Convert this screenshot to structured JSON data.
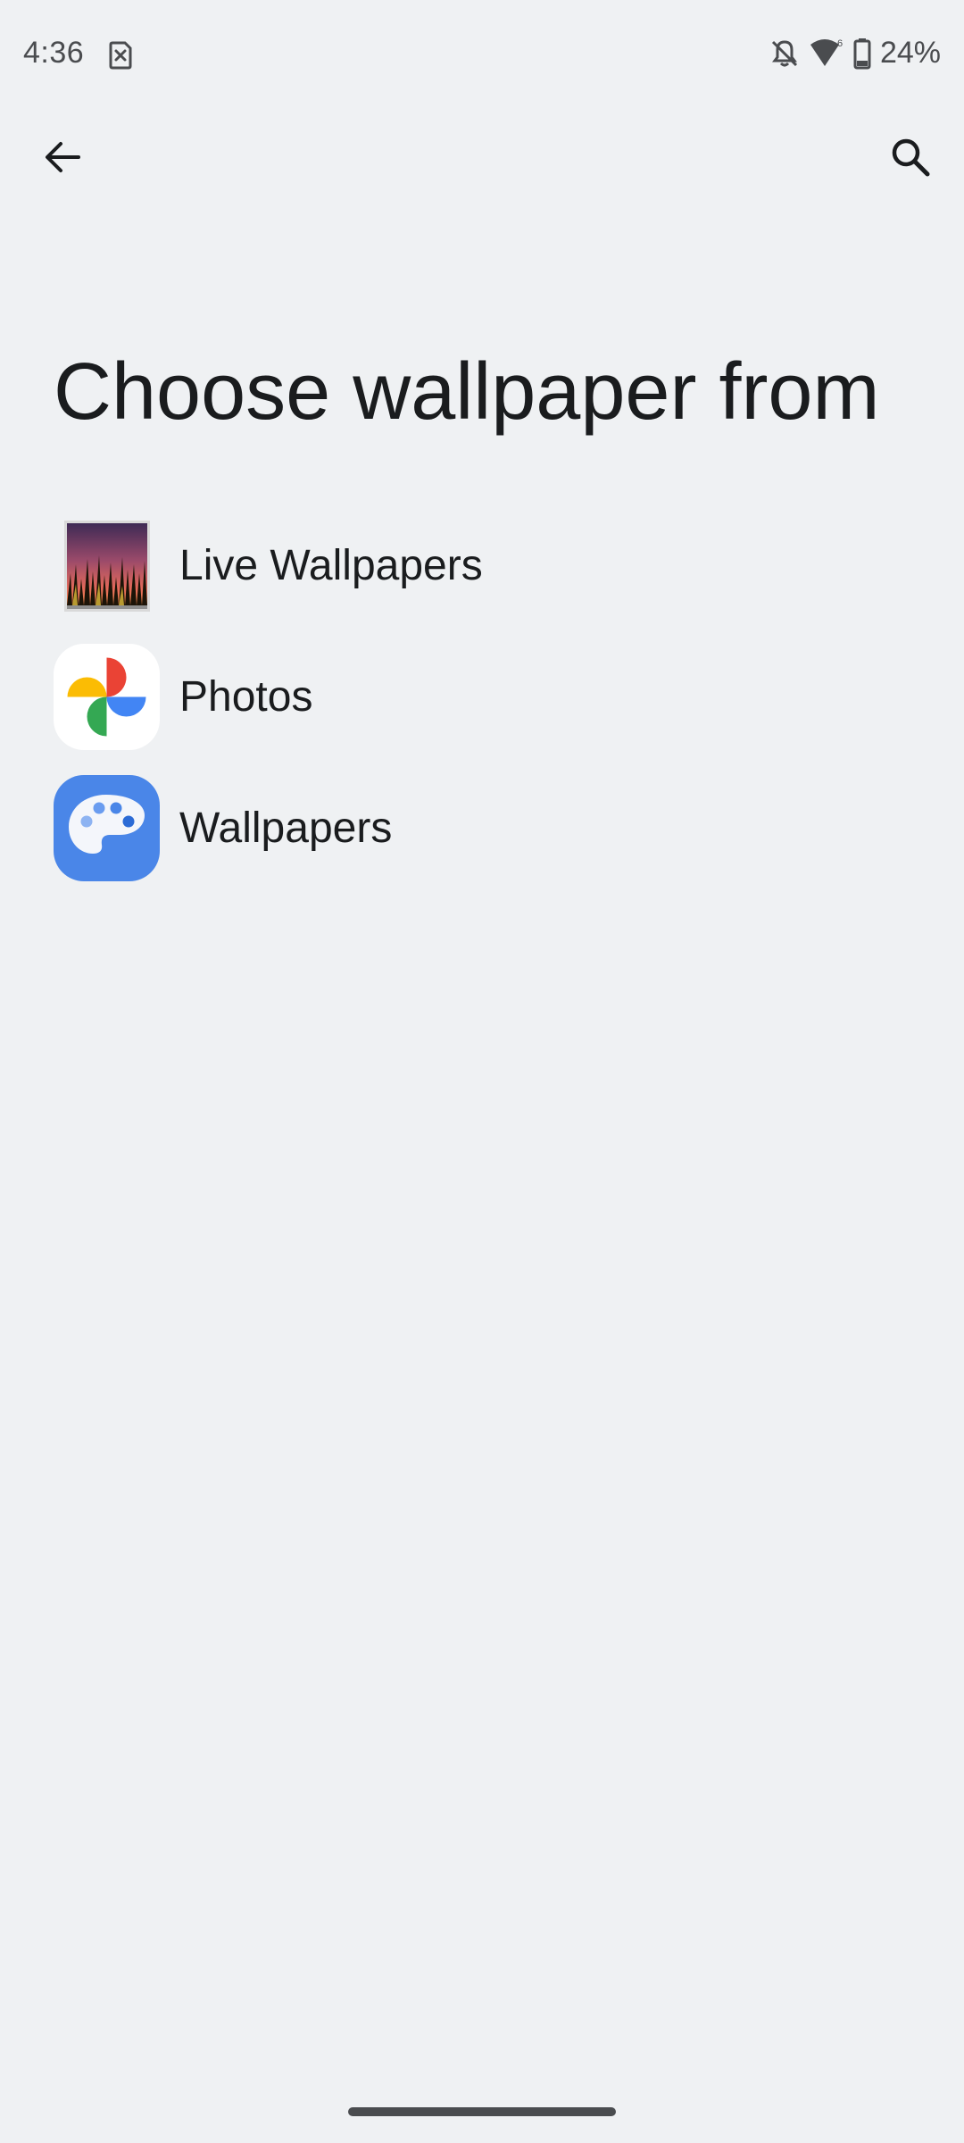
{
  "status_bar": {
    "time": "4:36",
    "battery_percent": "24%",
    "icons": [
      "sim-error-icon",
      "bell-off-icon",
      "wifi-icon",
      "battery-icon"
    ]
  },
  "app_bar": {
    "back_icon": "arrow-back-icon",
    "search_icon": "search-icon"
  },
  "page": {
    "title": "Choose wallpaper from"
  },
  "items": [
    {
      "label": "Live Wallpapers",
      "icon": "live-wallpapers-icon"
    },
    {
      "label": "Photos",
      "icon": "google-photos-icon"
    },
    {
      "label": "Wallpapers",
      "icon": "wallpapers-palette-icon"
    }
  ],
  "colors": {
    "background": "#eff1f3",
    "text": "#1a1c1e",
    "wallpapers_blue": "#4a86e8"
  }
}
